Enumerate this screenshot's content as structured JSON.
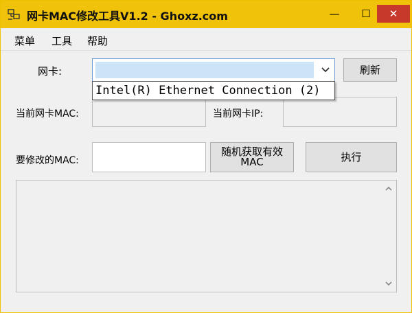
{
  "window": {
    "title": "网卡MAC修改工具V1.2 - Ghoxz.com",
    "controls": {
      "minimize": "—",
      "maximize": "☐",
      "close": "✕"
    },
    "titlebar_color": "#f0c20a",
    "close_color": "#c7392b"
  },
  "menu": {
    "items": [
      "菜单",
      "工具",
      "帮助"
    ]
  },
  "form": {
    "nic_label": "网卡:",
    "current_mac_label": "当前网卡MAC:",
    "current_ip_label": "当前网卡IP:",
    "modify_mac_label": "要修改的MAC:",
    "current_mac_value": "",
    "current_ip_value": "",
    "new_mac_value": ""
  },
  "combo": {
    "selected": "",
    "options": [
      "Intel(R) Ethernet Connection (2)"
    ]
  },
  "buttons": {
    "refresh": "刷新",
    "random_mac": "随机获取有效\nMAC",
    "execute": "执行"
  },
  "log": {
    "text": ""
  }
}
